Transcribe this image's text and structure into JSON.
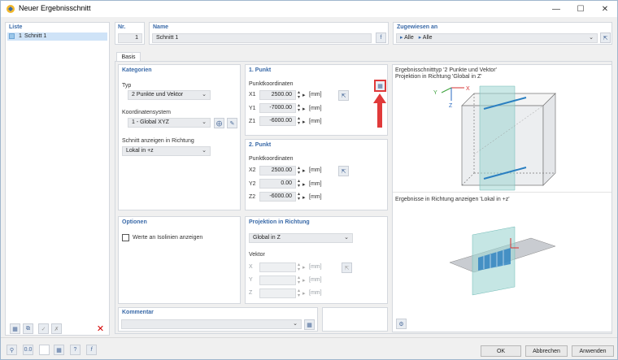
{
  "window": {
    "title": "Neuer Ergebnisschnitt"
  },
  "list": {
    "header": "Liste",
    "items": [
      {
        "number": "1",
        "name": "Schnitt 1"
      }
    ]
  },
  "nr": {
    "label": "Nr.",
    "value": "1"
  },
  "name": {
    "label": "Name",
    "value": "Schnitt 1"
  },
  "assigned": {
    "label": "Zugewiesen an",
    "value1": "Alle",
    "value2": "Alle"
  },
  "tabs": [
    "Basis"
  ],
  "kategorien": {
    "header": "Kategorien",
    "typ_label": "Typ",
    "typ_value": "2 Punkte und Vektor",
    "ks_label": "Koordinatensystem",
    "ks_value": "1 - Global XYZ",
    "schnitt_label": "Schnitt anzeigen in Richtung",
    "schnitt_value": "Lokal in +z"
  },
  "punkt1": {
    "header": "1. Punkt",
    "sub": "Punktkoordinaten",
    "rows": [
      {
        "label": "X1",
        "value": "2500.00",
        "unit": "[mm]"
      },
      {
        "label": "Y1",
        "value": "-7000.00",
        "unit": "[mm]"
      },
      {
        "label": "Z1",
        "value": "-6000.00",
        "unit": "[mm]"
      }
    ]
  },
  "punkt2": {
    "header": "2. Punkt",
    "sub": "Punktkoordinaten",
    "rows": [
      {
        "label": "X2",
        "value": "2500.00",
        "unit": "[mm]"
      },
      {
        "label": "Y2",
        "value": "0.00",
        "unit": "[mm]"
      },
      {
        "label": "Z2",
        "value": "-6000.00",
        "unit": "[mm]"
      }
    ]
  },
  "optionen": {
    "header": "Optionen",
    "checkbox_label": "Werte an Isolinien anzeigen"
  },
  "projektion": {
    "header": "Projektion in Richtung",
    "value": "Global in Z",
    "vektor_label": "Vektor",
    "rows": [
      {
        "label": "X",
        "unit": "[mm]"
      },
      {
        "label": "Y",
        "unit": "[mm]"
      },
      {
        "label": "Z",
        "unit": "[mm]"
      }
    ]
  },
  "kommentar": {
    "header": "Kommentar"
  },
  "preview": {
    "text1": "Ergebnisschnitttyp '2 Punkte und Vektor'",
    "text2": "Projektion in Richtung 'Global in Z'",
    "text3": "Ergebnisse in Richtung anzeigen 'Lokal in +z'",
    "axis_x": "X",
    "axis_y": "Y",
    "axis_z": "Z"
  },
  "footer": {
    "ok": "OK",
    "cancel": "Abbrechen",
    "apply": "Anwenden"
  },
  "colors": {
    "header_blue": "#3a6aa8",
    "highlight_red": "#e03a3a",
    "plane": "#9fd6d2",
    "line": "#2a7fc1"
  }
}
